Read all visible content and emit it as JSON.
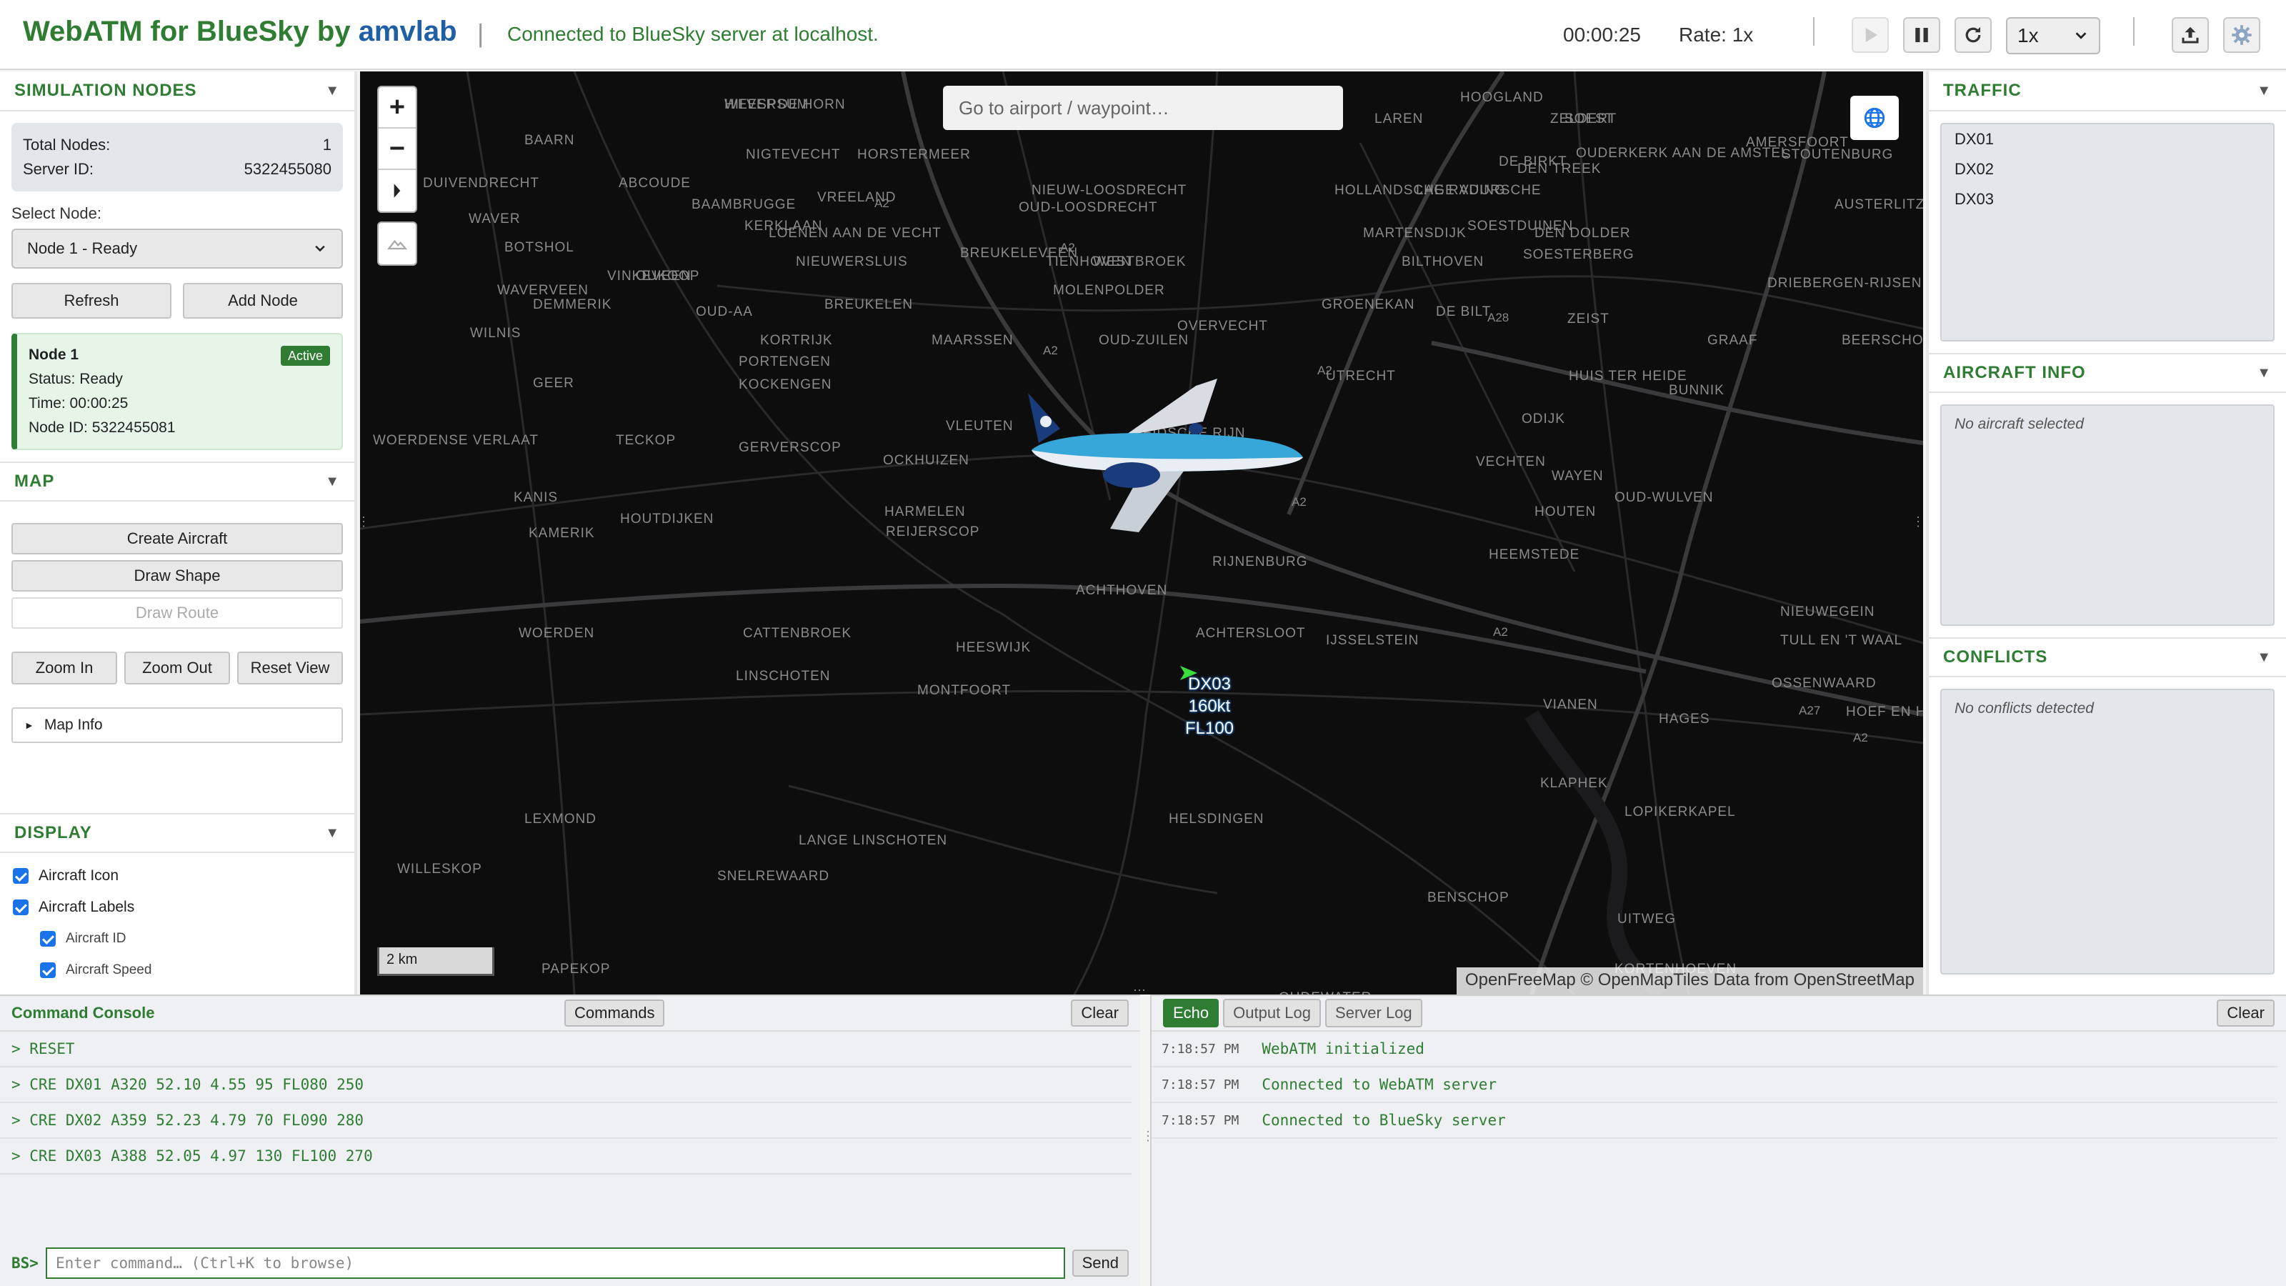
{
  "header": {
    "title": "WebATM for BlueSky by ",
    "title_brand": "amvlab",
    "separator": "|",
    "status": "Connected to BlueSky server at localhost.",
    "time": "00:00:25",
    "rate": "Rate: 1x",
    "speed_value": "1x"
  },
  "left": {
    "sim_nodes": {
      "title": "SIMULATION NODES",
      "total_label": "Total Nodes:",
      "total_value": "1",
      "server_label": "Server ID:",
      "server_value": "5322455080",
      "select_label": "Select Node:",
      "select_value": "Node 1 - Ready",
      "refresh": "Refresh",
      "add_node": "Add Node",
      "card": {
        "title": "Node 1",
        "badge": "Active",
        "status": "Status: Ready",
        "time": "Time: 00:00:25",
        "node_id": "Node ID: 5322455081"
      }
    },
    "map": {
      "title": "MAP",
      "create_aircraft": "Create Aircraft",
      "draw_shape": "Draw Shape",
      "draw_route": "Draw Route",
      "zoom_in": "Zoom In",
      "zoom_out": "Zoom Out",
      "reset_view": "Reset View",
      "map_info": "Map Info"
    },
    "display": {
      "title": "DISPLAY",
      "items": [
        "Aircraft Icon",
        "Aircraft Labels",
        "Aircraft ID",
        "Aircraft Speed"
      ]
    }
  },
  "right": {
    "traffic": {
      "title": "TRAFFIC",
      "items": [
        "DX01",
        "DX02",
        "DX03"
      ]
    },
    "aircraft_info": {
      "title": "AIRCRAFT INFO",
      "empty": "No aircraft selected"
    },
    "conflicts": {
      "title": "CONFLICTS",
      "empty": "No conflicts detected"
    }
  },
  "map": {
    "search_placeholder": "Go to airport / waypoint…",
    "scale": "2 km",
    "attribution": "OpenFreeMap © OpenMapTiles Data from OpenStreetMap",
    "aircraft_label": {
      "id": "DX03",
      "speed": "160kt",
      "alt": "FL100"
    },
    "places": [
      "WEESP",
      "DE HORN",
      "NIGTEVECHT",
      "HORSTERMEER",
      "VREELAND",
      "BREUKELEVEEN",
      "LOENEN AAN DE VECHT",
      "NIEUWERSLUIS",
      "OUD-LOOSDRECHT",
      "NIEUW-LOOSDRECHT",
      "TIENHOVEN",
      "WESTBROEK",
      "MOLENPOLDER",
      "BREUKELEN",
      "KORTRIJK",
      "PORTENGEN",
      "KOCKENGEN",
      "MAARSSEN",
      "OUD-ZUILEN",
      "OVERVECHT",
      "UTRECHT",
      "LEIDSCHE RIJN",
      "VLEUTEN",
      "GERVERSCOP",
      "OCKHUIZEN",
      "HARMELEN",
      "REIJERSCOP",
      "ACHTHOVEN",
      "RIJNENBURG",
      "ACHTERSLOOT",
      "IJSSELSTEIN",
      "MONTFOORT",
      "HEESWIJK",
      "CATTENBROEK",
      "LINSCHOTEN",
      "WOERDEN",
      "KAMERIK",
      "KANIS",
      "HOUTDIJKEN",
      "TECKOP",
      "GEER",
      "WOERDENSE VERLAAT",
      "WILNIS",
      "DEMMERIK",
      "VINKEVEEN",
      "WAVERVEEN",
      "BOTSHOL",
      "WAVER",
      "ABCOUDE",
      "BAAMBRUGGE",
      "KERKLAAN",
      "OUKOOP",
      "OUD-AA",
      "GROENEKAN",
      "DE BILT",
      "ZEIST",
      "BILTHOVEN",
      "MARTENSDIJK",
      "HOLLANDSCHE RADING",
      "LAGE VUURSCHE",
      "SOESTDUINEN",
      "DEN DOLDER",
      "SOESTERBERG",
      "HUIS TER HEIDE",
      "BUNNIK",
      "ODIJK",
      "VECHTEN",
      "WAYEN",
      "OUD-WULVEN",
      "HOUTEN",
      "HEEMSTEDE",
      "NIEUWEGEIN",
      "TULL EN 'T WAAL",
      "OSSENWAARD",
      "HOEF EN HAAG",
      "HAGES",
      "VIANEN",
      "KLAPHEK",
      "LOPIKERKAPEL",
      "HELSDINGEN",
      "BENSCHOP",
      "UITWEG",
      "KORTENHOEVEN",
      "LEXMOND",
      "LANGE LINSCHOTEN",
      "SNELREWAARD",
      "WILLESKOP",
      "PAPEKOP",
      "OUDEWATER",
      "GRAAF",
      "BEERSCHOTEN",
      "DRIEBERGEN-RIJSENBURG",
      "AUSTERLITZ",
      "DEN TREEK",
      "DE BIRKT",
      "SOEST",
      "ZELDERT",
      "HOOGLAND",
      "BAARN",
      "DUIVENDRECHT",
      "OUDERKERK AAN DE AMSTEL",
      "AMERSFOORT",
      "STOUTENBURG",
      "LEUSDEN",
      "BUSSUM",
      "LAREN",
      "HILVERSUM"
    ],
    "roads": [
      "A2",
      "A2",
      "A2",
      "A2",
      "A2",
      "A28",
      "A27",
      "A2",
      "A2",
      "A2"
    ]
  },
  "console": {
    "title": "Command Console",
    "commands_btn": "Commands",
    "clear": "Clear",
    "lines": [
      "> RESET",
      "> CRE DX01 A320 52.10 4.55 95 FL080 250",
      "> CRE DX02 A359 52.23 4.79 70 FL090 280",
      "> CRE DX03 A388 52.05 4.97 130 FL100 270"
    ],
    "prompt": "BS>",
    "input_placeholder": "Enter command… (Ctrl+K to browse)",
    "send": "Send"
  },
  "log": {
    "tabs": [
      "Echo",
      "Output Log",
      "Server Log"
    ],
    "clear": "Clear",
    "entries": [
      {
        "time": "7:18:57 PM",
        "msg": "WebATM initialized"
      },
      {
        "time": "7:18:57 PM",
        "msg": "Connected to WebATM server"
      },
      {
        "time": "7:18:57 PM",
        "msg": "Connected to BlueSky server"
      }
    ]
  },
  "colors": {
    "accent": "#2e7d32",
    "brand": "#1e5fa6",
    "map_bg": "#0d0d0e"
  }
}
